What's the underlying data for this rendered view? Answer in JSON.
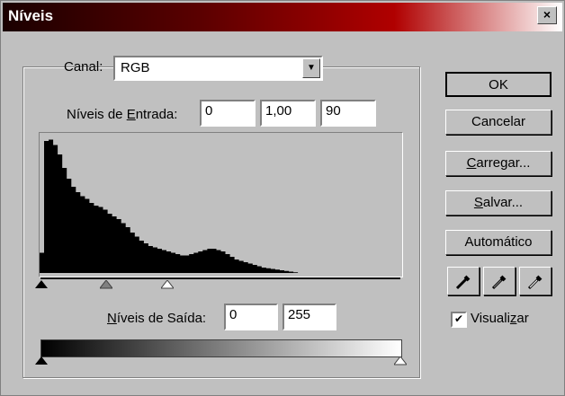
{
  "window": {
    "title": "Níveis",
    "close_glyph": "×"
  },
  "channel": {
    "label": "Canal:",
    "value": "RGB"
  },
  "input_levels": {
    "label_pre": "Níveis de ",
    "label_u": "E",
    "label_post": "ntrada:",
    "black": "0",
    "gamma": "1,00",
    "white": "90"
  },
  "output_levels": {
    "label_u": "N",
    "label_post": "íveis de Saída:",
    "black": "0",
    "white": "255"
  },
  "buttons": {
    "ok": "OK",
    "cancel": "Cancelar",
    "load_u": "C",
    "load_rest": "arregar...",
    "save_u": "S",
    "save_rest": "alvar...",
    "auto": "Automático"
  },
  "eyedroppers": [
    "black-point-eyedropper-icon",
    "gray-point-eyedropper-icon",
    "white-point-eyedropper-icon"
  ],
  "preview": {
    "label_pre": "Visuali",
    "label_u": "z",
    "label_post": "ar",
    "checked": true,
    "check_glyph": "✔"
  },
  "histogram": {
    "heights": [
      0.15,
      0.98,
      0.99,
      0.95,
      0.88,
      0.78,
      0.7,
      0.64,
      0.6,
      0.57,
      0.55,
      0.52,
      0.5,
      0.49,
      0.47,
      0.44,
      0.42,
      0.4,
      0.37,
      0.34,
      0.3,
      0.27,
      0.24,
      0.22,
      0.2,
      0.19,
      0.18,
      0.17,
      0.16,
      0.15,
      0.14,
      0.13,
      0.13,
      0.14,
      0.15,
      0.16,
      0.17,
      0.18,
      0.18,
      0.17,
      0.16,
      0.14,
      0.12,
      0.1,
      0.09,
      0.08,
      0.07,
      0.06,
      0.05,
      0.04,
      0.035,
      0.03,
      0.025,
      0.02,
      0.015,
      0.01,
      0.005,
      0,
      0,
      0,
      0,
      0,
      0,
      0,
      0,
      0,
      0,
      0,
      0,
      0,
      0,
      0,
      0,
      0,
      0,
      0,
      0,
      0,
      0,
      0
    ]
  },
  "colors": {
    "title_start": "#1a0000",
    "title_end": "#ffffff",
    "dialog_bg": "#c0c0c0"
  }
}
